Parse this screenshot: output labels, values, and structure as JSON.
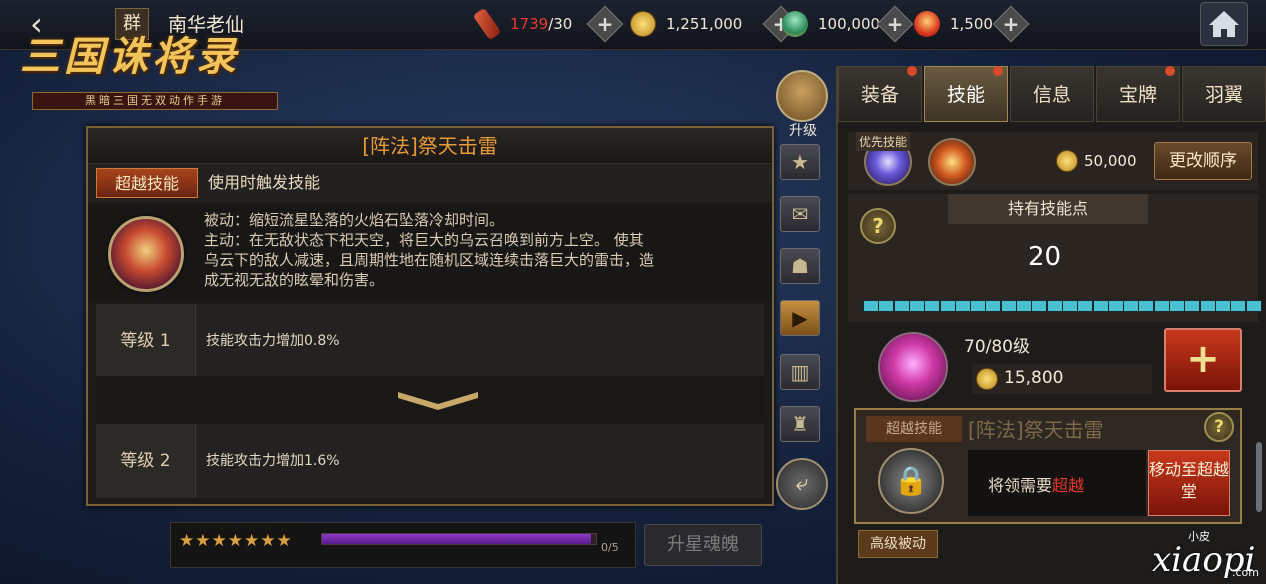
{
  "header": {
    "back_icon": "back-chevron-icon",
    "group_badge": "群",
    "player_name": "南华老仙",
    "logo_title": "三国诛将录",
    "logo_subtitle": "黑暗三国无双动作手游",
    "resources": [
      {
        "name": "stamina",
        "icon": "scroll-icon",
        "value": "1739",
        "max": "/30",
        "color": "#e83a2a"
      },
      {
        "name": "copper",
        "icon": "coin-icon",
        "value": "1,251,000",
        "max": ""
      },
      {
        "name": "jade",
        "icon": "jade-icon",
        "value": "100,000",
        "max": ""
      },
      {
        "name": "ingot",
        "icon": "ingot-icon",
        "value": "1,500",
        "max": ""
      }
    ],
    "home_icon": "home-icon"
  },
  "skill_detail": {
    "title": "[阵法]祭天击雷",
    "type_tag": "超越技能",
    "type_desc": "使用时触发技能",
    "desc_lines": [
      "被动：缩短流星坠落的火焰石坠落冷却时间。",
      "主动：在无敌状态下祀天空，将巨大的乌云召唤到前方上空。 使其",
      "乌云下的敌人减速，且周期性地在随机区域连续击落巨大的雷击，造",
      "成无视无敌的眩晕和伤害。"
    ],
    "levels": [
      {
        "label": "等级 1",
        "effect": "技能攻击力增加0.8%"
      },
      {
        "label": "等级 2",
        "effect": "技能攻击力增加1.6%"
      }
    ]
  },
  "star_bar": {
    "stars": "★★★★★★★",
    "star_count": 7,
    "soul_progress": 0.98,
    "soul_count": "0/5",
    "upgrade_star_label": "升星魂魄"
  },
  "side_column": {
    "upgrade_label": "升级",
    "icons": [
      "star-icon",
      "chat-icon",
      "profile-icon",
      "play-icon",
      "ranking-icon",
      "helmet-icon"
    ],
    "share_icon": "share-icon"
  },
  "right_panel": {
    "tabs": [
      {
        "label": "装备",
        "dot": true,
        "active": false
      },
      {
        "label": "技能",
        "dot": true,
        "active": true
      },
      {
        "label": "信息",
        "dot": false,
        "active": false
      },
      {
        "label": "宝牌",
        "dot": true,
        "active": false
      },
      {
        "label": "羽翼",
        "dot": false,
        "active": false
      }
    ],
    "priority_label": "优先技能",
    "priority_cost": "50,000",
    "reorder_label": "更改顺序",
    "points_header": "持有技能点",
    "points_value": "20",
    "points_segments": 26,
    "upgrade_level": "70/80级",
    "upgrade_cost": "15,800",
    "transcend": {
      "tag": "超越技能",
      "name": "[阵法]祭天击雷",
      "req_prefix": "将领需要",
      "req_em": "超越",
      "move_label": "移动至超越堂"
    },
    "advanced_tag": "高级被动"
  },
  "watermark": {
    "small": "小皮",
    "big": "xiaopi",
    "com": ".com"
  }
}
